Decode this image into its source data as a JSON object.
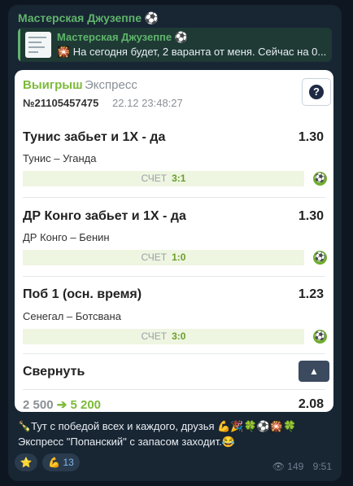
{
  "channel": {
    "name": "Мастерская Джузеппе ⚽"
  },
  "reply": {
    "name": "Мастерская Джузеппе ⚽",
    "text": "🎇 На сегодня будет, 2 варанта от меня. Сейчас на 0..."
  },
  "ticket": {
    "status": "Выигрыш",
    "type": "Экспресс",
    "number": "№21105457475",
    "date": "22.12 23:48:27",
    "help_label": "?",
    "bets": [
      {
        "title": "Тунис забьет и 1Х - да",
        "odd": "1.30",
        "match": "Тунис – Уганда",
        "score_label": "СЧЕТ",
        "score": "3:1"
      },
      {
        "title": "ДР Конго забьет и 1Х - да",
        "odd": "1.30",
        "match": "ДР Конго – Бенин",
        "score_label": "СЧЕТ",
        "score": "1:0"
      },
      {
        "title": "Поб 1 (осн. время)",
        "odd": "1.23",
        "match": "Сенегал – Ботсвана",
        "score_label": "СЧЕТ",
        "score": "3:0"
      }
    ],
    "collapse_label": "Свернуть",
    "stake": "2 500",
    "payout": "5 200",
    "total_odd": "2.08"
  },
  "message": {
    "line1": "🍾Тут с победой всех и каждого, друзья 💪🎉🍀⚽🎇🍀",
    "line2": "Экспресс \"Попанский\" с запасом заходит.😂"
  },
  "reactions": [
    {
      "emoji": "⭐",
      "count": ""
    },
    {
      "emoji": "💪",
      "count": "13"
    }
  ],
  "meta": {
    "views": "149",
    "time": "9:51"
  }
}
